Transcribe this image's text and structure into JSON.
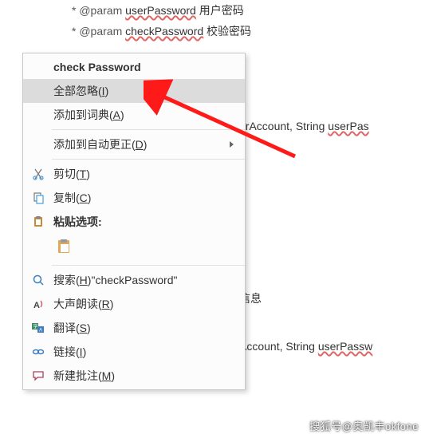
{
  "doc": {
    "line1_prefix": " * @param ",
    "line1_param": "userPassword",
    "line1_desc": "  用户密码",
    "line2_prefix": " * @param ",
    "line2_param": "checkPassword",
    "line2_desc": " 校验密码"
  },
  "bgtext": {
    "snippet1a": "erAccount, String ",
    "snippet1b": "userPas",
    "info": "信息",
    "snippet2a": "Account, String ",
    "snippet2b": "userPassw"
  },
  "menu": {
    "suggestion": "check Password",
    "ignore_all": "全部忽略(",
    "ignore_all_key": "I",
    "ignore_all_end": ")",
    "add_dict": "添加到词典(",
    "add_dict_key": "A",
    "add_dict_end": ")",
    "autocorrect": "添加到自动更正(",
    "autocorrect_key": "D",
    "autocorrect_end": ")",
    "cut": "剪切(",
    "cut_key": "T",
    "cut_end": ")",
    "copy": "复制(",
    "copy_key": "C",
    "copy_end": ")",
    "paste_options": "粘贴选项:",
    "search_pre": "搜索(",
    "search_key": "H",
    "search_mid": ")\"",
    "search_term": "checkPassword",
    "search_end": "\"",
    "read_aloud": "大声朗读(",
    "read_aloud_key": "R",
    "read_aloud_end": ")",
    "translate": "翻译(",
    "translate_key": "S",
    "translate_end": ")",
    "link": "链接(",
    "link_key": "I",
    "link_end": ")",
    "new_comment": "新建批注(",
    "new_comment_key": "M",
    "new_comment_end": ")"
  },
  "watermark": "搜狐号@奥凯丰okfone"
}
